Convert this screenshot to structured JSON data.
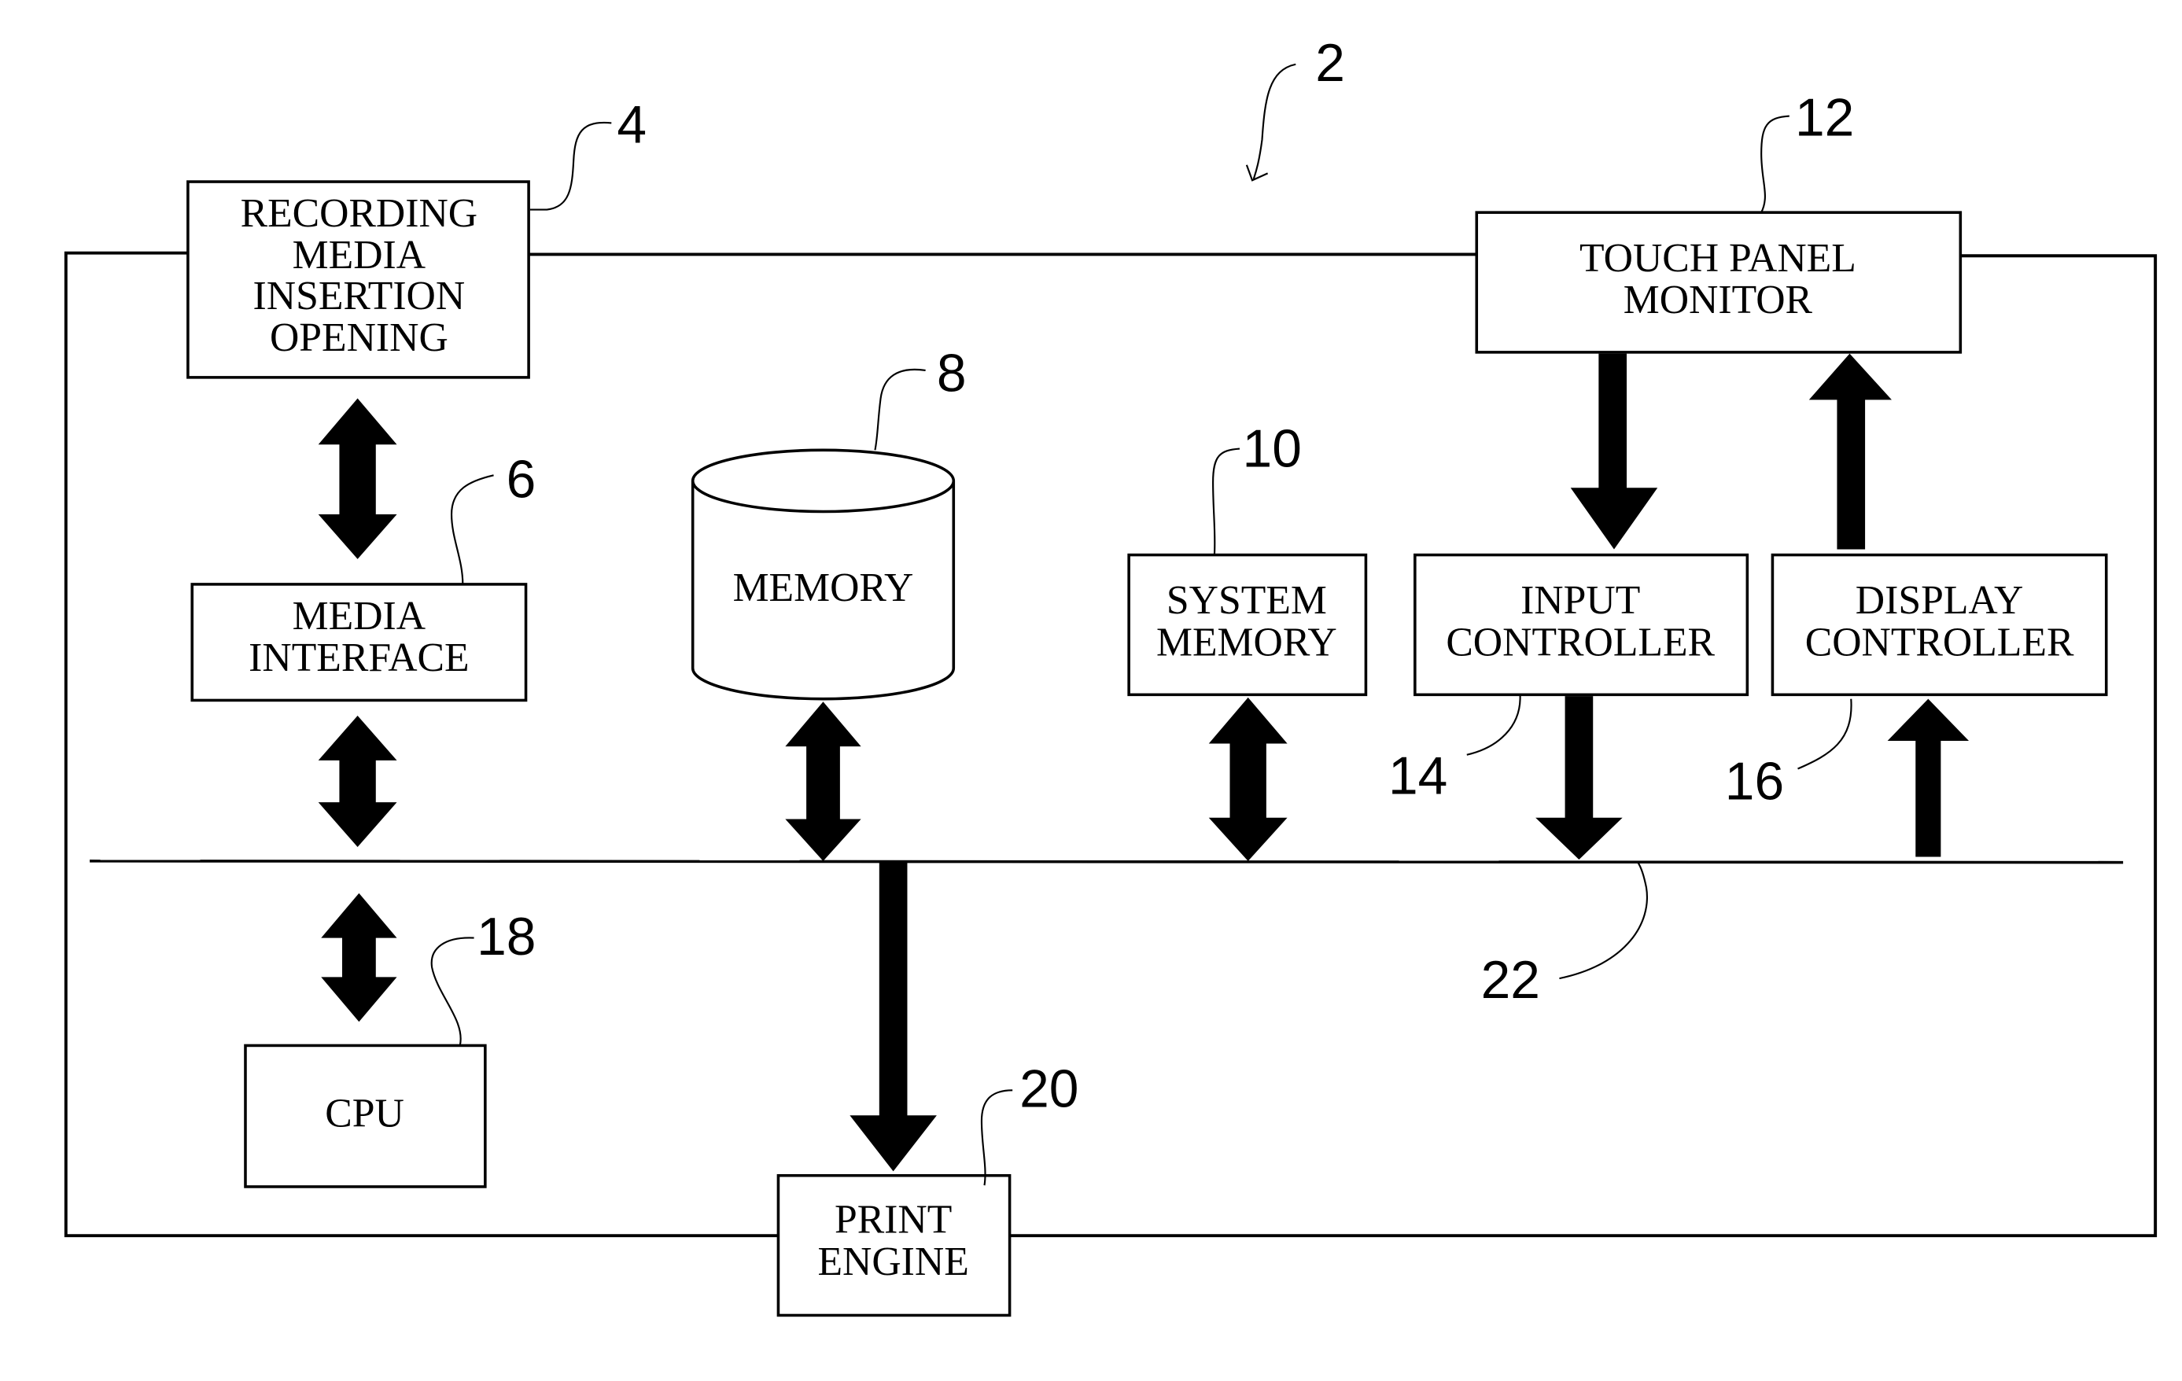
{
  "figure": {
    "ref": "2",
    "blocks": [
      {
        "id": "recording",
        "ref": "4",
        "lines": [
          "RECORDING",
          "MEDIA",
          "INSERTION",
          "OPENING"
        ]
      },
      {
        "id": "media-if",
        "ref": "6",
        "lines": [
          "MEDIA",
          "INTERFACE"
        ]
      },
      {
        "id": "memory",
        "ref": "8",
        "lines": [
          "MEMORY"
        ]
      },
      {
        "id": "sysmem",
        "ref": "10",
        "lines": [
          "SYSTEM",
          "MEMORY"
        ]
      },
      {
        "id": "touch",
        "ref": "12",
        "lines": [
          "TOUCH PANEL",
          "MONITOR"
        ]
      },
      {
        "id": "input",
        "ref": "14",
        "lines": [
          "INPUT",
          "CONTROLLER"
        ]
      },
      {
        "id": "display",
        "ref": "16",
        "lines": [
          "DISPLAY",
          "CONTROLLER"
        ]
      },
      {
        "id": "cpu",
        "ref": "18",
        "lines": [
          "CPU"
        ]
      },
      {
        "id": "print",
        "ref": "20",
        "lines": [
          "PRINT",
          "ENGINE"
        ]
      }
    ],
    "bus_ref": "22",
    "connections": [
      {
        "from": "recording",
        "to": "media-if",
        "dir": "both"
      },
      {
        "from": "media-if",
        "to": "bus",
        "dir": "both"
      },
      {
        "from": "memory",
        "to": "bus",
        "dir": "both"
      },
      {
        "from": "sysmem",
        "to": "bus",
        "dir": "both"
      },
      {
        "from": "touch",
        "to": "input",
        "dir": "forward"
      },
      {
        "from": "display",
        "to": "touch",
        "dir": "forward"
      },
      {
        "from": "input",
        "to": "bus",
        "dir": "forward"
      },
      {
        "from": "bus",
        "to": "display",
        "dir": "forward"
      },
      {
        "from": "bus",
        "to": "cpu",
        "dir": "both"
      },
      {
        "from": "bus",
        "to": "print",
        "dir": "forward"
      }
    ]
  }
}
